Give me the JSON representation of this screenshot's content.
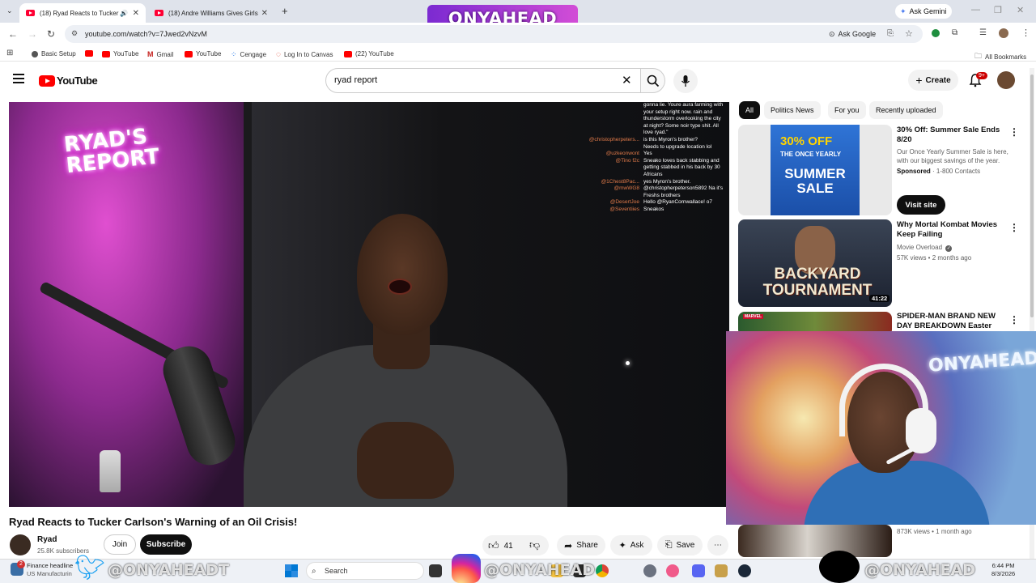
{
  "browser": {
    "tabs": [
      {
        "title": "(18) Ryad Reacts to Tucker",
        "active": true
      },
      {
        "title": "(18) Andre Williams Gives Girls",
        "active": false
      }
    ],
    "ask_gemini": "Ask Gemini",
    "url": "youtube.com/watch?v=7Jwed2vNzvM",
    "ask_google": "Ask Google",
    "bookmarks": [
      "Basic Setup",
      "YouTube",
      "Gmail",
      "YouTube",
      "Cengage",
      "Log In to Canvas",
      "(22) YouTube"
    ],
    "all_bookmarks": "All Bookmarks"
  },
  "youtube": {
    "logo": "YouTube",
    "search_value": "ryad report",
    "create_label": "Create",
    "notifications_badge": "9+"
  },
  "video": {
    "title": "Ryad Reacts to Tucker Carlson's Warning of an Oil Crisis!",
    "channel": "Ryad",
    "subscribers": "25.8K subscribers",
    "join": "Join",
    "subscribe": "Subscribe",
    "likes": "41",
    "share": "Share",
    "ask": "Ask",
    "save": "Save",
    "overlay_sign": "RYAD'S REPORT",
    "chat": [
      {
        "user": "",
        "msg": "gonna lie. Youre aura farming with"
      },
      {
        "user": "",
        "msg": "your setup right now. rain and"
      },
      {
        "user": "",
        "msg": "thunderstorm overlooking the city"
      },
      {
        "user": "",
        "msg": "at night? Some noir type shit. All"
      },
      {
        "user": "",
        "msg": "love ryad.\""
      },
      {
        "user": "@christopherpeters...",
        "msg": "is this Myron's brother?"
      },
      {
        "user": "",
        "msg": "Needs to upgrade location lol"
      },
      {
        "user": "@uzkeonwont",
        "msg": "Yes"
      },
      {
        "user": "@Tino f2c",
        "msg": "Sneako loves back stabbing and"
      },
      {
        "user": "",
        "msg": "getting stabbed in his back by 30"
      },
      {
        "user": "",
        "msg": "Africans"
      },
      {
        "user": "@1Chest8Pac...",
        "msg": "yes Myron's brother."
      },
      {
        "user": "@mwWG8",
        "msg": "@christopherpeterson5892 Na it's"
      },
      {
        "user": "",
        "msg": "Freshs brothers"
      },
      {
        "user": "@DesertJoe",
        "msg": "Hello @RyanCornwallace! o7"
      },
      {
        "user": "@Seventiies",
        "msg": "Sneakos"
      }
    ]
  },
  "sidebar": {
    "chips": [
      "All",
      "Politics News",
      "For you",
      "Recently uploaded"
    ],
    "items": [
      {
        "title": "30% Off: Summer Sale Ends 8/20",
        "desc": "Our Once Yearly Summer Sale is here, with our biggest savings of the year.",
        "sponsored": "Sponsored",
        "contacts": "1-800 Contacts",
        "cta": "Visit site",
        "thumb_text": [
          "30% OFF",
          "THE ONCE YEARLY",
          "SUMMER SALE"
        ]
      },
      {
        "title": "Why Mortal Kombat Movies Keep Failing",
        "channel": "Movie Overload",
        "meta": "57K views • 2 months ago",
        "duration": "41:22",
        "thumb_text": "BACKYARD TOURNAMENT"
      },
      {
        "title": "SPIDER-MAN BRAND NEW DAY BREAKDOWN Easter Eggs & ...",
        "thumb_text": "MARVEL"
      },
      {
        "meta": "873K views • 1 month ago"
      }
    ]
  },
  "webcam": {
    "sign": "ONYAHEAD"
  },
  "watermarks": {
    "top": "ONYAHEAD",
    "twitter": "@ONYAHEADT",
    "instagram": "@ONYAHEAD",
    "tiktok": "@ONYAHEAD"
  },
  "taskbar": {
    "news_title": "Finance headline",
    "news_sub": "US Manufacturin",
    "badge": "2",
    "search": "Search",
    "time": "6:44 PM",
    "date": "8/3/2026"
  },
  "colors": {
    "yt_red": "#ff0000",
    "accent_purple": "#8a2be2",
    "chat_user": "#e07a4a"
  }
}
